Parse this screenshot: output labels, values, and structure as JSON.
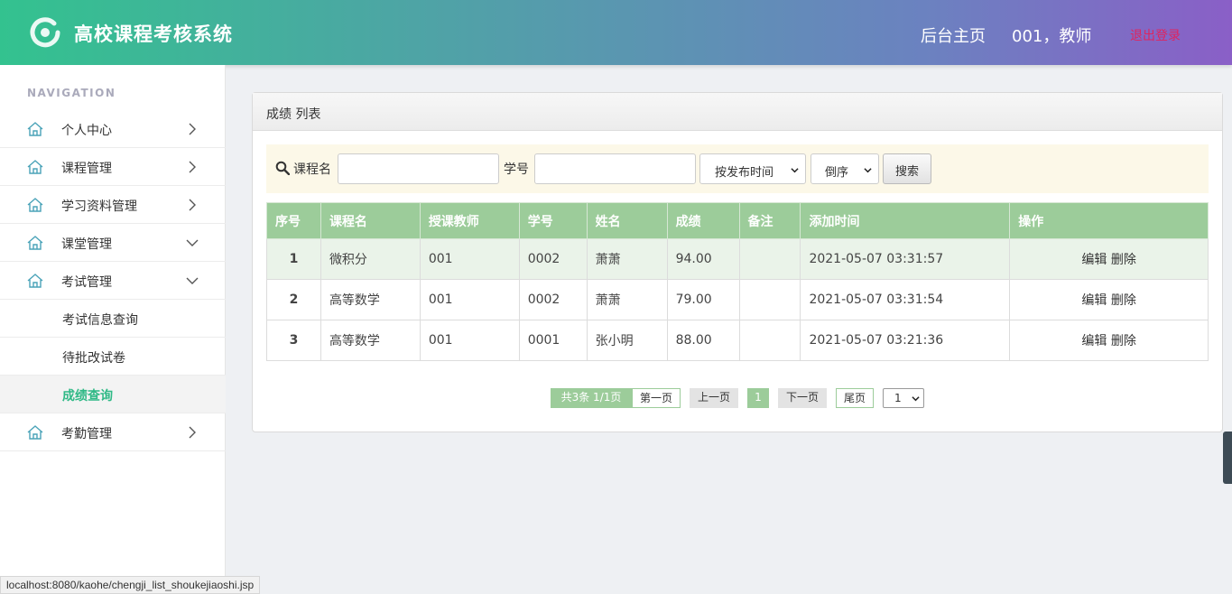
{
  "header": {
    "app_title": "高校课程考核系统",
    "home_link": "后台主页",
    "user": "001，教师",
    "logout": "退出登录"
  },
  "sidebar": {
    "heading": "NAVIGATION",
    "items": [
      {
        "label": "个人中心",
        "icon": "home-icon",
        "arrow": "chevron-right-icon"
      },
      {
        "label": "课程管理",
        "icon": "home-icon",
        "arrow": "chevron-right-icon"
      },
      {
        "label": "学习资料管理",
        "icon": "home-icon",
        "arrow": "chevron-right-icon"
      },
      {
        "label": "课堂管理",
        "icon": "home-icon",
        "arrow": "chevron-down-icon"
      },
      {
        "label": "考试管理",
        "icon": "home-icon",
        "arrow": "chevron-down-icon"
      }
    ],
    "sub_items": [
      {
        "label": "考试信息查询"
      },
      {
        "label": "待批改试卷"
      },
      {
        "label": "成绩查询",
        "active": true
      }
    ],
    "last_item": {
      "label": "考勤管理",
      "icon": "home-icon",
      "arrow": "chevron-right-icon"
    }
  },
  "panel": {
    "title": "成绩 列表"
  },
  "search": {
    "course_label": "课程名",
    "course_value": "",
    "student_id_label": "学号",
    "student_id_value": "",
    "sort_field": "按发布时间",
    "sort_order": "倒序",
    "button": "搜索"
  },
  "table": {
    "headers": [
      "序号",
      "课程名",
      "授课教师",
      "学号",
      "姓名",
      "成绩",
      "备注",
      "添加时间",
      "操作"
    ],
    "rows": [
      {
        "idx": "1",
        "course": "微积分",
        "teacher": "001",
        "sid": "0002",
        "name": "萧萧",
        "score": "94.00",
        "note": "",
        "time": "2021-05-07 03:31:57",
        "edit": "编辑",
        "delete": "删除"
      },
      {
        "idx": "2",
        "course": "高等数学",
        "teacher": "001",
        "sid": "0002",
        "name": "萧萧",
        "score": "79.00",
        "note": "",
        "time": "2021-05-07 03:31:54",
        "edit": "编辑",
        "delete": "删除"
      },
      {
        "idx": "3",
        "course": "高等数学",
        "teacher": "001",
        "sid": "0001",
        "name": "张小明",
        "score": "88.00",
        "note": "",
        "time": "2021-05-07 03:21:36",
        "edit": "编辑",
        "delete": "删除"
      }
    ]
  },
  "pager": {
    "info": "共3条  1/1页",
    "first": "第一页",
    "prev": "上一页",
    "current": "1",
    "next": "下一页",
    "last": "尾页",
    "select": "1"
  },
  "statusbar": {
    "url": "localhost:8080/kaohe/chengji_list_shoukejiaoshi.jsp"
  },
  "colors": {
    "accent_green": "#2fb986",
    "table_header": "#9ccc9a",
    "logout_red": "#e0245e"
  }
}
